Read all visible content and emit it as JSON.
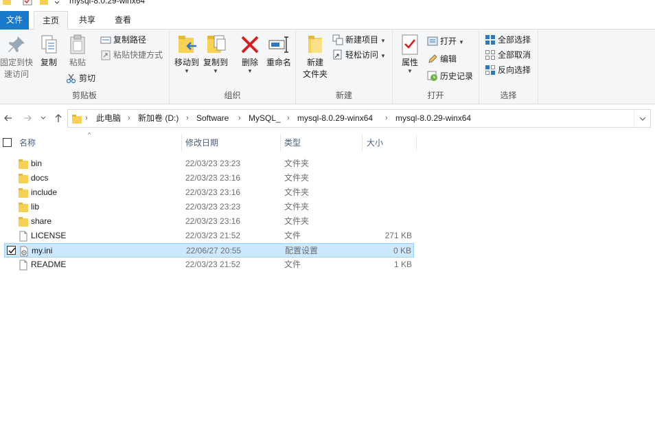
{
  "window": {
    "title": "mysql-8.0.29-winx64"
  },
  "tabs": {
    "file": "文件",
    "home": "主页",
    "share": "共享",
    "view": "查看"
  },
  "ribbon": {
    "clipboard": {
      "label": "剪贴板",
      "pin": "固定到快\n速访问",
      "copy": "复制",
      "paste": "粘贴",
      "copy_path": "复制路径",
      "paste_shortcut": "粘贴快捷方式",
      "cut": "剪切"
    },
    "organize": {
      "label": "组织",
      "move_to": "移动到",
      "copy_to": "复制到",
      "delete": "删除",
      "rename": "重命名"
    },
    "new": {
      "label": "新建",
      "new_folder": "新建\n文件夹",
      "new_item": "新建项目",
      "easy_access": "轻松访问"
    },
    "open": {
      "label": "打开",
      "properties": "属性",
      "open": "打开",
      "edit": "编辑",
      "history": "历史记录"
    },
    "select": {
      "label": "选择",
      "select_all": "全部选择",
      "select_none": "全部取消",
      "invert": "反向选择"
    }
  },
  "address": {
    "crumbs": [
      "此电脑",
      "新加卷 (D:)",
      "Software",
      "MySQL_",
      "mysql-8.0.29-winx64",
      "mysql-8.0.29-winx64"
    ]
  },
  "columns": {
    "name": "名称",
    "modified": "修改日期",
    "type": "类型",
    "size": "大小"
  },
  "files": [
    {
      "name": "bin",
      "modified": "22/03/23 23:23",
      "type": "文件夹",
      "size": "",
      "icon": "folder-icon"
    },
    {
      "name": "docs",
      "modified": "22/03/23 23:16",
      "type": "文件夹",
      "size": "",
      "icon": "folder-icon"
    },
    {
      "name": "include",
      "modified": "22/03/23 23:16",
      "type": "文件夹",
      "size": "",
      "icon": "folder-icon"
    },
    {
      "name": "lib",
      "modified": "22/03/23 23:23",
      "type": "文件夹",
      "size": "",
      "icon": "folder-icon"
    },
    {
      "name": "share",
      "modified": "22/03/23 23:16",
      "type": "文件夹",
      "size": "",
      "icon": "folder-icon"
    },
    {
      "name": "LICENSE",
      "modified": "22/03/23 21:52",
      "type": "文件",
      "size": "271 KB",
      "icon": "file-icon"
    },
    {
      "name": "my.ini",
      "modified": "22/06/27 20:55",
      "type": "配置设置",
      "size": "0 KB",
      "icon": "settings-file-icon",
      "selected": true
    },
    {
      "name": "README",
      "modified": "22/03/23 21:52",
      "type": "文件",
      "size": "1 KB",
      "icon": "file-icon"
    }
  ],
  "colors": {
    "accent": "#1979ca",
    "selection": "#cce8ff",
    "selection_border": "#99d1ff",
    "delete_red": "#d42020"
  }
}
